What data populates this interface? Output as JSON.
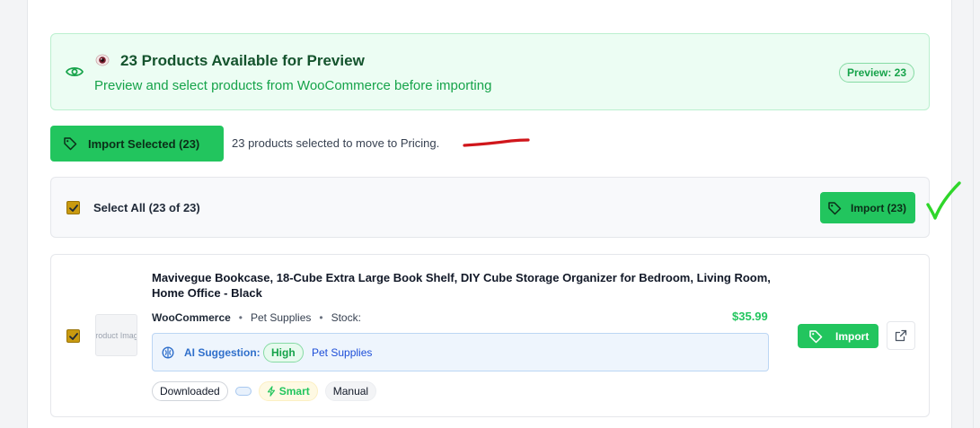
{
  "banner": {
    "title": "23 Products Available for Preview",
    "subtitle": "Preview and select products from WooCommerce before importing",
    "badge": "Preview: 23",
    "icon": "eye-icon",
    "emoji_icon": "eye-emoji-icon"
  },
  "actions": {
    "import_selected_label": "Import Selected (23)",
    "selected_note": "23 products selected to move to Pricing."
  },
  "select_bar": {
    "label": "Select All (23 of 23)",
    "checked": true,
    "import_label": "Import (23)"
  },
  "product": {
    "title": "Mavivegue Bookcase, 18-Cube Extra Large Book Shelf, DIY Cube Storage Organizer for Bedroom, Living Room, Home Office - Black",
    "thumb_alt": "Product Image",
    "source": "WooCommerce",
    "category": "Pet Supplies",
    "stock_label": "Stock:",
    "price": "$35.99",
    "checked": true,
    "ai": {
      "label": "AI Suggestion:",
      "confidence": "High",
      "category": "Pet Supplies"
    },
    "tags": [
      "Downloaded",
      "",
      "Smart",
      "Manual"
    ],
    "import_label": "Import"
  },
  "colors": {
    "accent_green": "#22c55e",
    "banner_bg": "#ecfdf3",
    "ai_blue": "#2f6fcb",
    "checkbox": "#c99a10",
    "annotation_red": "#d0161b",
    "annotation_green": "#2fd62a"
  }
}
